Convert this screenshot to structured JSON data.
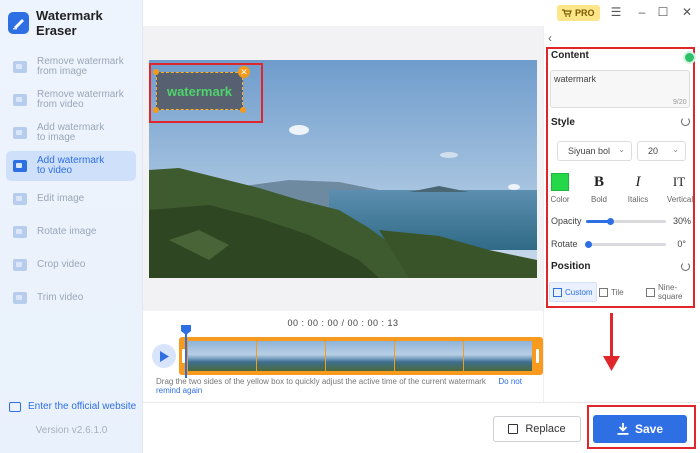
{
  "app": {
    "title": "Watermark Eraser",
    "version": "Version v2.6.1.0",
    "website_label": "Enter the official website"
  },
  "sidebar": {
    "items": [
      {
        "label": "Remove watermark from image",
        "line1": "Remove watermark",
        "line2": "from image",
        "icon": "image-icon",
        "active": false
      },
      {
        "label": "Remove watermark from video",
        "line1": "Remove watermark",
        "line2": "from video",
        "icon": "video-icon",
        "active": false
      },
      {
        "label": "Add watermark to image",
        "line1": "Add watermark",
        "line2": "to image",
        "icon": "image-plus-icon",
        "active": false
      },
      {
        "label": "Add watermark to video",
        "line1": "Add watermark",
        "line2": "to video",
        "icon": "video-plus-icon",
        "active": true
      },
      {
        "label": "Edit image",
        "line1": "Edit image",
        "line2": "",
        "icon": "edit-icon",
        "active": false
      },
      {
        "label": "Rotate image",
        "line1": "Rotate image",
        "line2": "",
        "icon": "rotate-icon",
        "active": false
      },
      {
        "label": "Crop video",
        "line1": "Crop video",
        "line2": "",
        "icon": "crop-icon",
        "active": false
      },
      {
        "label": "Trim video",
        "line1": "Trim video",
        "line2": "",
        "icon": "trim-icon",
        "active": false
      }
    ]
  },
  "topbar": {
    "pro_label": "PRO"
  },
  "preview": {
    "watermark_text": "watermark"
  },
  "timeline": {
    "timecode": "00 : 00 : 00 / 00 : 00 : 13",
    "hint_text": "Drag the two sides of the yellow box to quickly adjust the active time of the current watermark",
    "hint_link": "Do not remind again"
  },
  "panel": {
    "content_title": "Content",
    "content_value": "watermark",
    "content_count": "9/20",
    "style_title": "Style",
    "font_family": "Siyuan bol",
    "font_size": "20",
    "color_label": "Color",
    "bold_label": "Bold",
    "italics_label": "Italics",
    "vertical_label": "Vertical",
    "bold_glyph": "B",
    "italic_glyph": "I",
    "vertical_glyph": "IT",
    "color_value": "#25d84a",
    "opacity_label": "Opacity",
    "opacity_value": "30%",
    "opacity_fraction": 0.3,
    "rotate_label": "Rotate",
    "rotate_value": "0°",
    "rotate_fraction": 0.0,
    "position_title": "Position",
    "position_options": [
      "Custom",
      "Tile",
      "Nine-square"
    ]
  },
  "actions": {
    "replace_label": "Replace",
    "save_label": "Save"
  },
  "colors": {
    "accent": "#2f6fe4",
    "highlight_red": "#e0262b",
    "timeline_orange": "#f89a1e"
  }
}
